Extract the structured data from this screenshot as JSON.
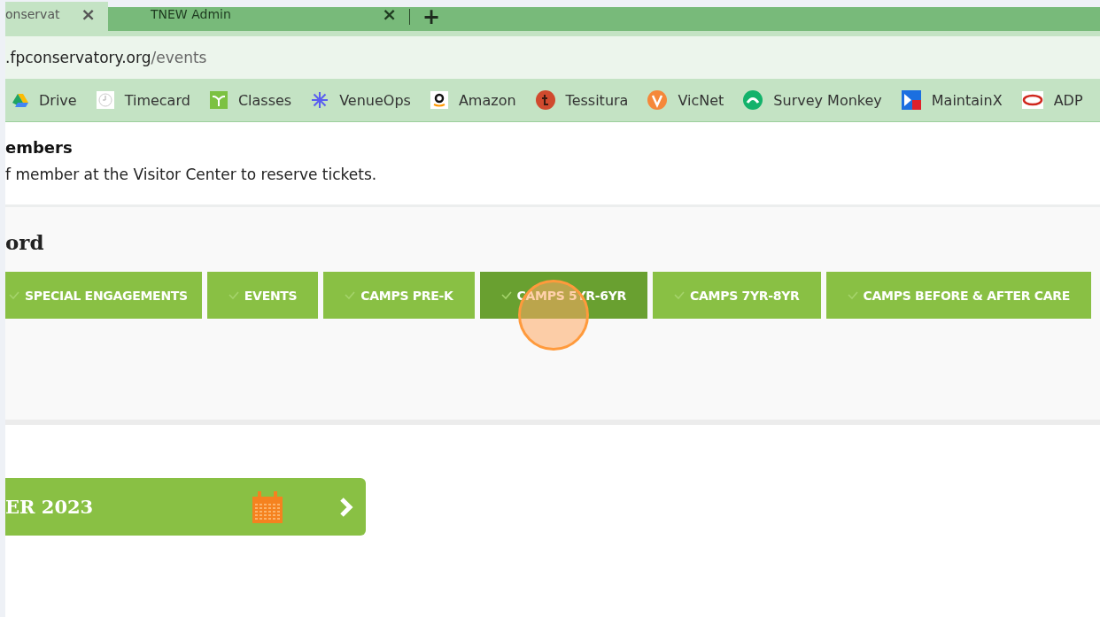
{
  "browser": {
    "tabs": [
      {
        "title": "onservat",
        "close": "×",
        "selected": true
      },
      {
        "title": "TNEW Admin",
        "close": "×",
        "selected": false
      }
    ],
    "new_tab": "+",
    "address": {
      "host": ".fpconservatory.org",
      "path": "/events"
    },
    "bookmarks": [
      {
        "label": "Drive",
        "kind": "drive"
      },
      {
        "label": "Timecard",
        "kind": "clock"
      },
      {
        "label": "Classes",
        "kind": "sprout"
      },
      {
        "label": "VenueOps",
        "kind": "asterisk"
      },
      {
        "label": "Amazon",
        "kind": "amazon"
      },
      {
        "label": "Tessitura",
        "kind": "tessitura"
      },
      {
        "label": "VicNet",
        "kind": "vicnet"
      },
      {
        "label": "Survey Monkey",
        "kind": "survey"
      },
      {
        "label": "MaintainX",
        "kind": "maintainx"
      },
      {
        "label": "ADP",
        "kind": "adp"
      }
    ]
  },
  "notice": {
    "title": "embers",
    "text": "f member at the Visitor Center to reserve tickets."
  },
  "section": {
    "heading": "ord",
    "filters": [
      {
        "label": "SPECIAL ENGAGEMENTS",
        "selected": false
      },
      {
        "label": "EVENTS",
        "selected": false
      },
      {
        "label": "CAMPS PRE-K",
        "selected": false
      },
      {
        "label": "CAMPS 5YR-6YR",
        "selected": true
      },
      {
        "label": "CAMPS 7YR-8YR",
        "selected": false
      },
      {
        "label": "CAMPS BEFORE & AFTER CARE",
        "selected": false
      }
    ]
  },
  "month_bar": {
    "label": "ER 2023"
  },
  "click_marker": true
}
